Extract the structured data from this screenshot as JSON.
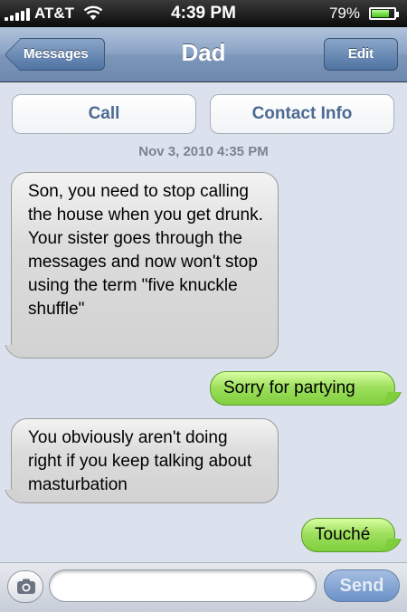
{
  "status_bar": {
    "carrier": "AT&T",
    "time": "4:39 PM",
    "battery_percent": "79%",
    "battery_level": 0.79
  },
  "nav": {
    "back_label": "Messages",
    "title": "Dad",
    "edit_label": "Edit"
  },
  "actions": {
    "call_label": "Call",
    "contact_info_label": "Contact Info"
  },
  "conversation": {
    "timestamp": "Nov 3, 2010 4:35 PM",
    "messages": [
      {
        "sender": "them",
        "text": "Son, you need to stop calling the house when you get drunk. Your sister goes through the messages and now won't stop using the term \"five knuckle shuffle\""
      },
      {
        "sender": "me",
        "text": "Sorry for partying"
      },
      {
        "sender": "them",
        "text": "You obviously aren't doing right if you keep talking about masturbation"
      },
      {
        "sender": "me",
        "text": "Touché"
      }
    ]
  },
  "composer": {
    "input_value": "",
    "send_label": "Send"
  },
  "colors": {
    "incoming_bubble": "#d2d2d2",
    "outgoing_bubble": "#7fcf3c",
    "background": "#dbe2ed",
    "nav_bar": "#7d97ba"
  }
}
